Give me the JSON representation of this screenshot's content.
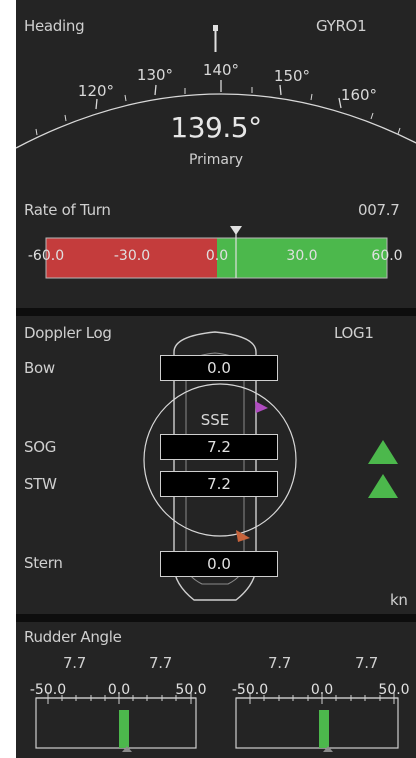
{
  "heading": {
    "title": "Heading",
    "source": "GYRO1",
    "ticks": [
      "120°",
      "130°",
      "140°",
      "150°",
      "160°"
    ],
    "value": "139.5°",
    "mode": "Primary"
  },
  "rate_of_turn": {
    "title": "Rate of Turn",
    "value": "007.7",
    "scale": [
      "-60.0",
      "-30.0",
      "0.0",
      "30.0",
      "60.0"
    ],
    "min": -60,
    "max": 60,
    "current": 7.7,
    "colors": {
      "port": "#c43c3c",
      "starboard": "#4cb84c"
    }
  },
  "doppler_log": {
    "title": "Doppler Log",
    "source": "LOG1",
    "bow_label": "Bow",
    "bow_value": "0.0",
    "direction": "SSE",
    "sog_label": "SOG",
    "sog_value": "7.2",
    "stw_label": "STW",
    "stw_value": "7.2",
    "stern_label": "Stern",
    "stern_value": "0.0",
    "unit": "kn",
    "colors": {
      "indicator": "#4cb84c",
      "sog_marker": "#b04cc0",
      "stw_marker": "#c8643c"
    }
  },
  "rudder": {
    "title": "Rudder Angle",
    "values": [
      "7.7",
      "7.7",
      "7.7",
      "7.7"
    ],
    "scale": [
      "-50.0",
      "0.0",
      "50.0"
    ],
    "bar_color": "#4cb84c"
  }
}
